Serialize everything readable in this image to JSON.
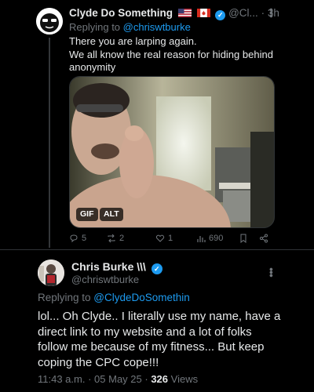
{
  "reply": {
    "author_name": "Clyde Do Something",
    "author_handle": "@Cl...",
    "separator": "·",
    "time": "3h",
    "replying_prefix": "Replying to ",
    "replying_handle": "@chriswtburke",
    "text": "There you are larping again.\nWe all know the real reason for hiding behind anonymity",
    "media_badges": {
      "gif": "GIF",
      "alt": "ALT"
    },
    "stats": {
      "replies": "5",
      "reposts": "2",
      "likes": "1",
      "views": "690"
    }
  },
  "main": {
    "author_name": "Chris Burke \\\\\\",
    "author_handle": "@chriswtburke",
    "replying_prefix": "Replying to ",
    "replying_handle": "@ClydeDoSomethin",
    "text": "lol... Oh Clyde.. I literally use my name, have a direct link to my website and a lot of folks follow me because of my fitness... But keep coping the CPC cope!!!",
    "time": "11:43 a.m.",
    "date": "05 May 25",
    "views_count": "326",
    "views_label": "Views"
  },
  "colors": {
    "background": "#000000",
    "text": "#e7e9ea",
    "muted": "#71767b",
    "accent": "#1d9bf0",
    "border": "#2f3336"
  },
  "icons": [
    "avatar-sunglasses",
    "us-flag-icon",
    "canada-flag-icon",
    "verified-badge-icon",
    "more-icon",
    "reply-icon",
    "repost-icon",
    "like-icon",
    "views-icon",
    "bookmark-icon",
    "share-icon"
  ]
}
